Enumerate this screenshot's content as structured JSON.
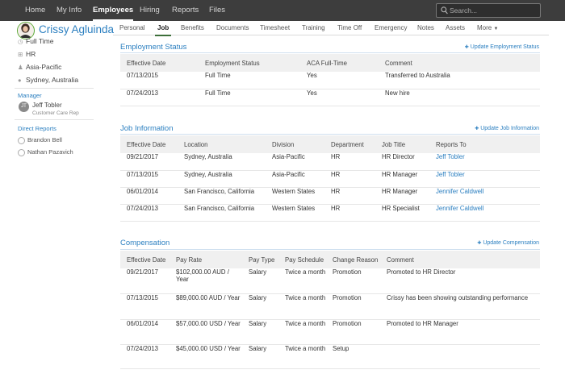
{
  "nav": {
    "items": [
      "Home",
      "My Info",
      "Employees",
      "Hiring",
      "Reports",
      "Files"
    ],
    "active": "Employees",
    "search_placeholder": "Search..."
  },
  "profile": {
    "name": "Crissy Agluinda",
    "tabs": [
      "Personal",
      "Job",
      "Benefits",
      "Documents",
      "Timesheet",
      "Training",
      "Time Off",
      "Emergency",
      "Notes",
      "Assets",
      "More"
    ],
    "active_tab": "Job"
  },
  "sidebar": {
    "status": "Full Time",
    "department": "HR",
    "division": "Asia-Pacific",
    "location": "Sydney, Australia",
    "manager_heading": "Manager",
    "manager_initials": "JT",
    "manager_name": "Jeff Tobler",
    "manager_title": "Customer Care Rep",
    "reports_heading": "Direct Reports",
    "reports": [
      "Brandon Bell",
      "Nathan Pazavich"
    ]
  },
  "employment_status": {
    "title": "Employment Status",
    "link": "Update Employment Status",
    "columns": [
      "Effective Date",
      "Employment Status",
      "ACA Full-Time",
      "Comment"
    ],
    "rows": [
      [
        "07/13/2015",
        "Full Time",
        "Yes",
        "Transferred to Australia"
      ],
      [
        "07/24/2013",
        "Full Time",
        "Yes",
        "New hire"
      ]
    ]
  },
  "job_information": {
    "title": "Job Information",
    "link": "Update Job Information",
    "columns": [
      "Effective Date",
      "Location",
      "Division",
      "Department",
      "Job Title",
      "Reports To"
    ],
    "rows": [
      [
        "09/21/2017",
        "Sydney, Australia",
        "Asia-Pacific",
        "HR",
        "HR Director",
        "Jeff Tobler"
      ],
      [
        "07/13/2015",
        "Sydney, Australia",
        "Asia-Pacific",
        "HR",
        "HR Manager",
        "Jeff Tobler"
      ],
      [
        "06/01/2014",
        "San Francisco, California",
        "Western States",
        "HR",
        "HR Manager",
        "Jennifer Caldwell"
      ],
      [
        "07/24/2013",
        "San Francisco, California",
        "Western States",
        "HR",
        "HR Specialist",
        "Jennifer Caldwell"
      ]
    ]
  },
  "compensation": {
    "title": "Compensation",
    "link": "Update Compensation",
    "columns": [
      "Effective Date",
      "Pay Rate",
      "Pay Type",
      "Pay Schedule",
      "Change Reason",
      "Comment"
    ],
    "rows": [
      [
        "09/21/2017",
        "$102,000.00 AUD / Year",
        "Salary",
        "Twice a month",
        "Promotion",
        "Promoted to HR Director"
      ],
      [
        "07/13/2015",
        "$89,000.00 AUD / Year",
        "Salary",
        "Twice a month",
        "Promotion",
        "Crissy has been showing outstanding performance"
      ],
      [
        "06/01/2014",
        "$57,000.00 USD / Year",
        "Salary",
        "Twice a month",
        "Promotion",
        "Promoted to HR Manager"
      ],
      [
        "07/24/2013",
        "$45,000.00 USD / Year",
        "Salary",
        "Twice a month",
        "Setup",
        ""
      ]
    ]
  },
  "colors": {
    "nav_bg": "#3d3d3d",
    "link_blue": "#2b7fc0",
    "avatar_ring": "#5aa832",
    "tab_underline": "#3d6f3a"
  }
}
